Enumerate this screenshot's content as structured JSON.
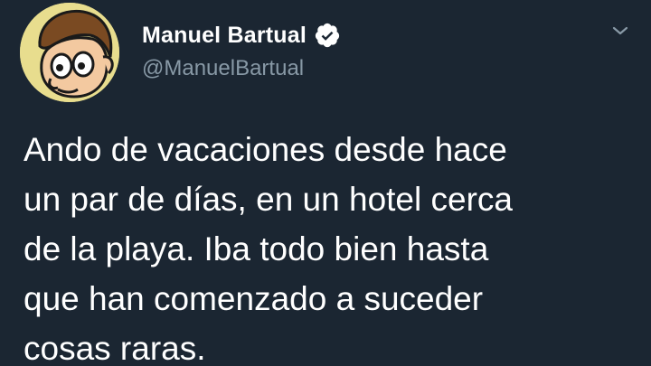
{
  "author": {
    "display_name": "Manuel Bartual",
    "handle": "@ManuelBartual",
    "verified": true,
    "avatar_icon": "cartoon-face-avatar"
  },
  "header": {
    "menu_icon": "chevron-down-icon"
  },
  "tweet": {
    "lines": [
      "Ando de vacaciones desde hace",
      "un par de días, en un hotel cerca",
      "de la playa. Iba todo bien hasta",
      "que han comenzado a suceder",
      "cosas raras."
    ]
  },
  "colors": {
    "background": "#1b2632",
    "text_primary": "#ffffff",
    "text_secondary": "#8899a6",
    "avatar_bg": "#e8dd8e"
  }
}
